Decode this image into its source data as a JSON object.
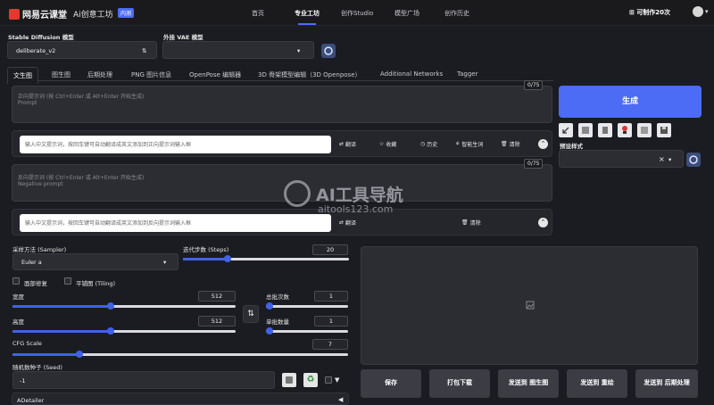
{
  "header": {
    "logo_text": "网易云课堂",
    "brand": "Ai创意工坊",
    "badge": "内测",
    "nav": [
      "首页",
      "专业工坊",
      "创作Studio",
      "模型广场",
      "创作历史"
    ],
    "active_nav": "专业工坊",
    "credits": "可制作20次",
    "credits_icon": "grid-icon",
    "chevron": "▾"
  },
  "models": {
    "sd_label": "Stable Diffusion 模型",
    "sd_value": "deliberate_v2",
    "sd_sort_icon": "⇅",
    "vae_label": "外挂 VAE 模型",
    "vae_value": "",
    "dropdown_arrow": "▾"
  },
  "tabs": [
    "文生图",
    "图生图",
    "后期处理",
    "PNG 图片信息",
    "OpenPose 编辑器",
    "3D 骨架模型编辑（3D Openpose）",
    "Additional Networks",
    "Tagger"
  ],
  "prompt": {
    "placeholder_cn": "正向提示词 (按 Ctrl+Enter 或 Alt+Enter 开始生成)",
    "placeholder_en": "Prompt",
    "counter": "0/75",
    "cn_input_placeholder": "输入中文提示词，按回车键可自动翻译成英文添加到正向提示词输入框",
    "actions": [
      "翻译",
      "收藏",
      "历史",
      "智能生词",
      "清除"
    ]
  },
  "negative": {
    "placeholder_cn": "反向提示词 (按 Ctrl+Enter 或 Alt+Enter 开始生成)",
    "placeholder_en": "Negative prompt",
    "counter": "0/75",
    "cn_input_placeholder": "输入中文提示词，按回车键可自动翻译成英文添加到反向提示词输入框",
    "actions": [
      "翻译",
      "清除"
    ]
  },
  "generate": {
    "label": "生成",
    "preset_label": "预设样式",
    "preset_clear": "×",
    "tool_icons": [
      "arrow-icon",
      "paste-icon",
      "trash-icon",
      "red-dot-icon",
      "clipboard-icon",
      "save-icon"
    ]
  },
  "params": {
    "sampler_label": "采样方法 (Sampler)",
    "sampler_value": "Euler a",
    "steps_label": "迭代步数 (Steps)",
    "steps_value": "20",
    "steps_fraction": 0.27,
    "face_restore": "面部修复",
    "tiling": "平铺图 (Tiling)",
    "width_label": "宽度",
    "width_value": "512",
    "width_fraction": 0.44,
    "height_label": "高度",
    "height_value": "512",
    "height_fraction": 0.44,
    "batch_count_label": "总批次数",
    "batch_count_value": "1",
    "batch_size_label": "单批数量",
    "batch_size_value": "1",
    "swap_icon": "⇅",
    "cfg_label": "CFG Scale",
    "cfg_value": "7",
    "cfg_fraction": 0.2,
    "seed_label": "随机数种子 (Seed)",
    "seed_value": "-1",
    "recycle_icon": "♻",
    "extra_arrow": "▼",
    "adetailer_label": "ADetailer"
  },
  "output": {
    "image_icon": "image-icon",
    "buttons": [
      "保存",
      "打包下载",
      "发送到 图生图",
      "发送到 重绘",
      "发送到 后期处理"
    ]
  },
  "watermark": {
    "title": "AI工具导航",
    "url": "aitools123.com"
  }
}
